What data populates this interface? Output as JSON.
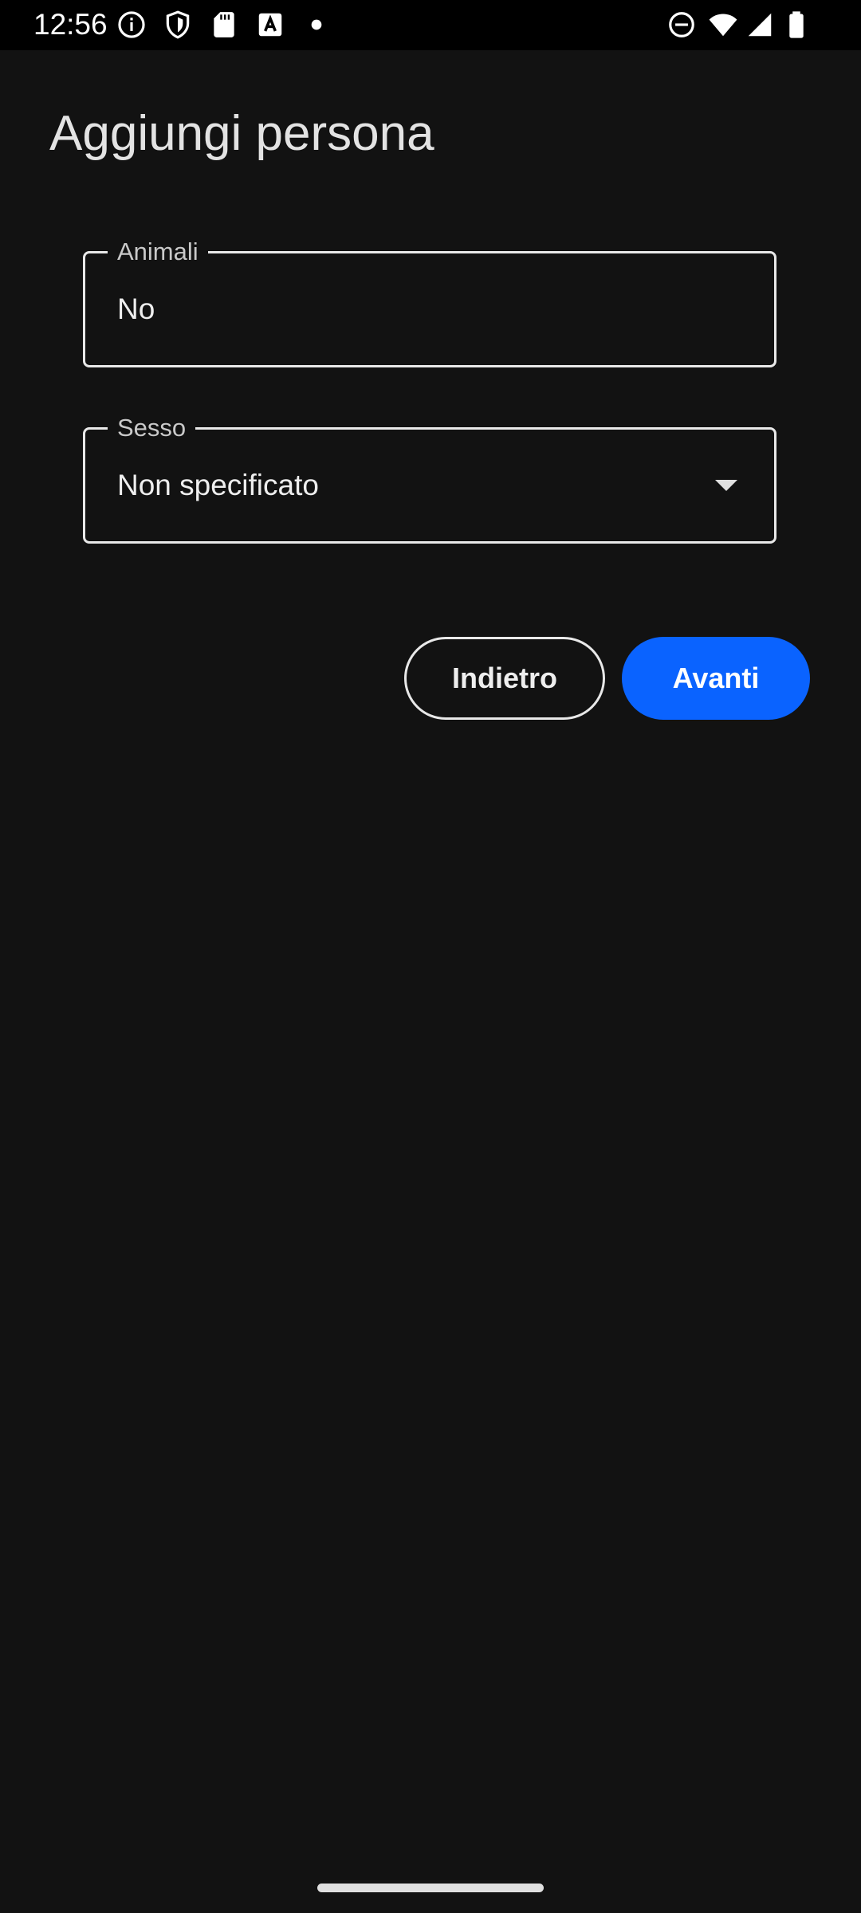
{
  "status_bar": {
    "time": "12:56",
    "left_icons": [
      "info-icon",
      "shield-icon",
      "sd-card-icon",
      "font-a-icon",
      "dot-icon"
    ],
    "right_icons": [
      "do-not-disturb-icon",
      "wifi-icon",
      "cellular-signal-icon",
      "battery-icon"
    ]
  },
  "page": {
    "title": "Aggiungi persona"
  },
  "form": {
    "animali": {
      "label": "Animali",
      "value": "No"
    },
    "sesso": {
      "label": "Sesso",
      "value": "Non specificato"
    }
  },
  "actions": {
    "back_label": "Indietro",
    "next_label": "Avanti"
  },
  "colors": {
    "background": "#121212",
    "accent": "#0a63ff",
    "outline": "#e8e8e8"
  }
}
